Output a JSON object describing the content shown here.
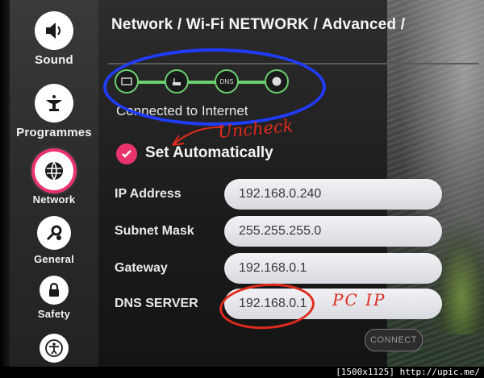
{
  "breadcrumb": "Network / Wi-Fi NETWORK / Advanced /",
  "sidebar": {
    "items": [
      {
        "label": "Sound",
        "icon": "speaker-icon"
      },
      {
        "label": "Programmes",
        "icon": "satellite-dish-icon"
      },
      {
        "label": "Network",
        "icon": "globe-icon",
        "active": true
      },
      {
        "label": "General",
        "icon": "gear-icon"
      },
      {
        "label": "Safety",
        "icon": "lock-icon"
      },
      {
        "label": "",
        "icon": "accessibility-icon"
      }
    ]
  },
  "status": {
    "nodes": [
      "tv-icon",
      "router-icon",
      "DNS",
      "globe-icon"
    ],
    "text": "Connected to Internet",
    "color": "#6ad16e"
  },
  "set_automatically": {
    "label": "Set Automatically",
    "checked": true
  },
  "fields": [
    {
      "label": "IP Address",
      "value": "192.168.0.240"
    },
    {
      "label": "Subnet Mask",
      "value": "255.255.255.0"
    },
    {
      "label": "Gateway",
      "value": "192.168.0.1"
    },
    {
      "label": "DNS SERVER",
      "value": "192.168.0.1"
    }
  ],
  "connect_label": "CONNECT",
  "annotations": {
    "uncheck": "Uncheck",
    "pc_ip": "PC IP"
  },
  "watermark": "[1500x1125] http://upic.me/",
  "colors": {
    "accent": "#e8336c",
    "annotation_red": "#e02a1e",
    "annotation_blue": "#1f3cff"
  }
}
